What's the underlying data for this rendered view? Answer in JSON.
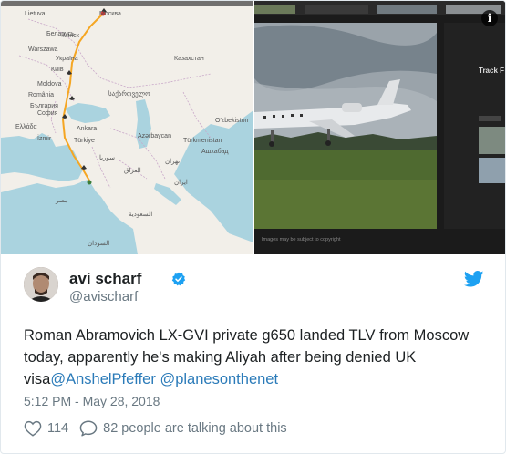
{
  "media": {
    "map_labels": {
      "lietuva": "Lietuva",
      "moskva": "Москва",
      "belarus": "Беларусь",
      "ukraine": "Україна",
      "moldova": "Moldova",
      "romania": "România",
      "bulgaria": "България",
      "ellada": "Ελλάδα",
      "turkiye": "Türkiye",
      "kazakhstan": "Казахстан",
      "uzbekiston": "O'zbekiston",
      "turkmenistan": "Türkmenistan",
      "azerbaycan": "Azərbaycan",
      "sakartvelo": "საქართველო",
      "ashgabat": "Ашхабад",
      "syria": "سوريا",
      "iraq": "العراق",
      "iran": "ایران",
      "misr": "مصر",
      "saudi": "السعودية",
      "sudan": "السودان",
      "tehran": "تهران",
      "izmir": "İzmir",
      "ankara": "Ankara",
      "kyiv": "Київ",
      "minsk": "Мінск",
      "warszawa": "Warszawa",
      "sofia": "София"
    },
    "photo_labels": {
      "side_title": "Track F",
      "caption": "Images may be subject to copyright"
    },
    "info_glyph": "i"
  },
  "user": {
    "name": "avi scharf",
    "handle": "@avischarf"
  },
  "tweet": {
    "text_before": "Roman Abramovich LX-GVI private g650 landed TLV from Moscow today, apparently he's making Aliyah after being denied UK visa",
    "mention1": "@AnshelPfeffer",
    "space": " ",
    "mention2": "@planesonthenet"
  },
  "timestamp": "5:12 PM - May 28, 2018",
  "actions": {
    "likes": "114",
    "replies_text": "82 people are talking about this"
  },
  "colors": {
    "accent": "#1da1f2",
    "mention": "#2b7bb9",
    "muted": "#697882",
    "flight_path": "#f5a623"
  },
  "icons": [
    "info-icon",
    "verified-badge-icon",
    "twitter-bird-icon",
    "heart-icon",
    "reply-bubble-icon"
  ]
}
